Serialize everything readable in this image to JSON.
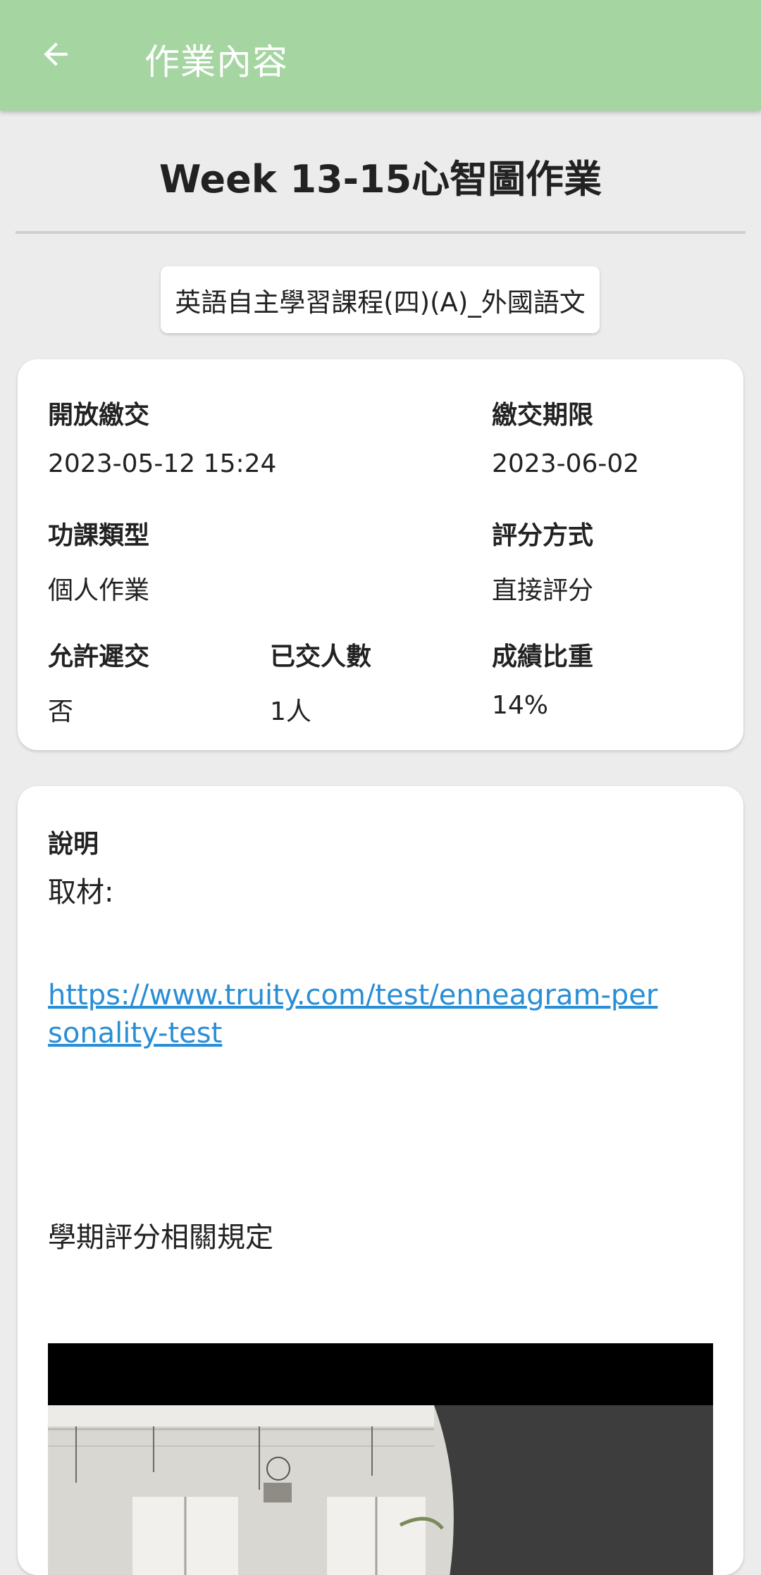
{
  "appbar": {
    "title": "作業內容",
    "back_icon": "arrow-back-icon"
  },
  "assignment": {
    "title": "Week 13-15心智圖作業",
    "course": "英語自主學習課程(四)(A)_外國語文"
  },
  "info": {
    "open_label": "開放繳交",
    "open_value": "2023-05-12 15:24",
    "deadline_label": "繳交期限",
    "deadline_value": "2023-06-02",
    "type_label": "功課類型",
    "type_value": "個人作業",
    "grading_label": "評分方式",
    "grading_value": "直接評分",
    "late_label": "允許遲交",
    "late_value": "否",
    "submitted_label": "已交人數",
    "submitted_value": "1人",
    "weight_label": "成績比重",
    "weight_value": "14%"
  },
  "description": {
    "label": "說明",
    "line1": "取材:",
    "link": "https://www.truity.com/test/enneagram-personality-test",
    "line2": "學期評分相關規定"
  },
  "colors": {
    "appbar": "#a5d6a2",
    "background": "#ececec",
    "link": "#2a8ed6"
  }
}
